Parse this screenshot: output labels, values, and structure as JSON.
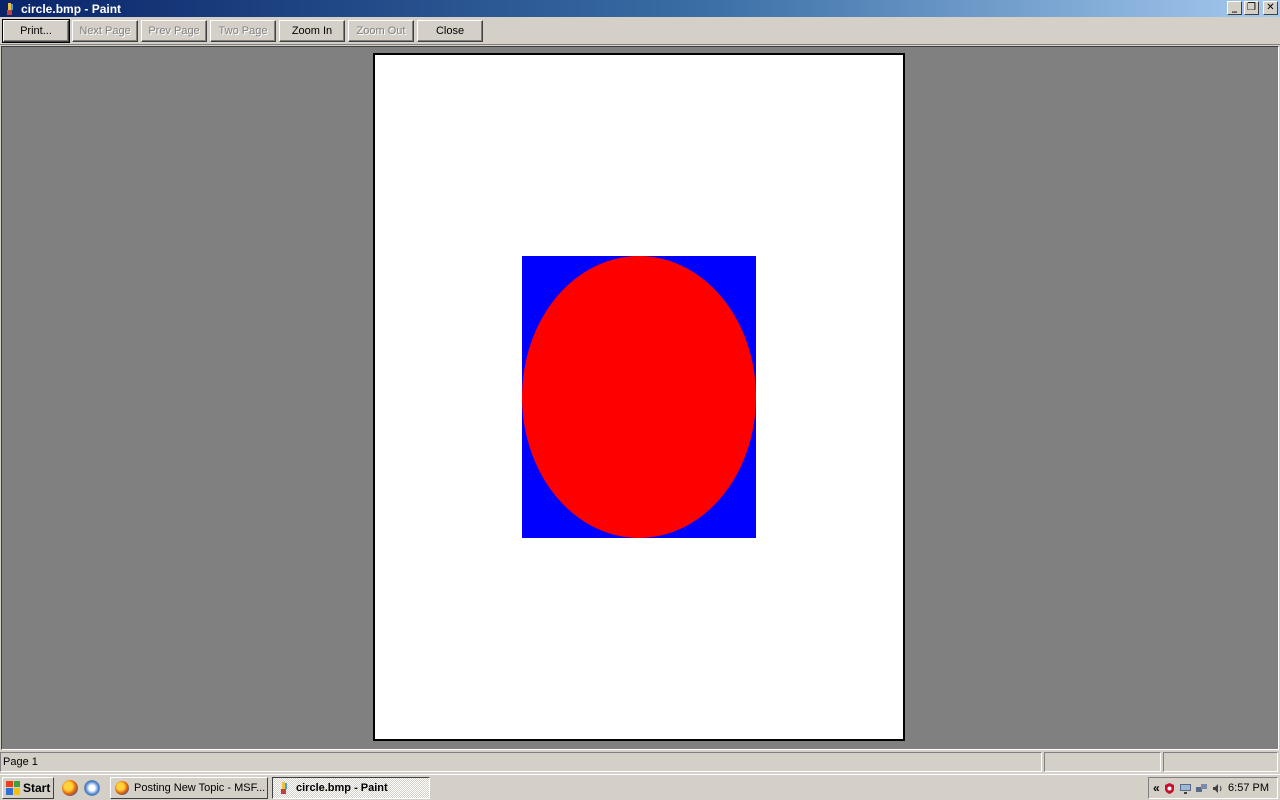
{
  "window": {
    "title": "circle.bmp - Paint",
    "controls": [
      "minimize",
      "restore",
      "close"
    ]
  },
  "toolbar": {
    "buttons": [
      {
        "label": "Print...",
        "enabled": true
      },
      {
        "label": "Next Page",
        "enabled": false
      },
      {
        "label": "Prev Page",
        "enabled": false
      },
      {
        "label": "Two Page",
        "enabled": false
      },
      {
        "label": "Zoom In",
        "enabled": true
      },
      {
        "label": "Zoom Out",
        "enabled": false
      },
      {
        "label": "Close",
        "enabled": true
      }
    ]
  },
  "preview": {
    "image_colors": {
      "background": "#0000ff",
      "ellipse": "#ff0000"
    }
  },
  "status": {
    "page": "Page 1"
  },
  "taskbar": {
    "start_label": "Start",
    "tasks": [
      {
        "label": "Posting New Topic - MSF...",
        "icon": "firefox-icon",
        "active": false
      },
      {
        "label": "circle.bmp - Paint",
        "icon": "paint-icon",
        "active": true
      }
    ],
    "tray_expand": "«",
    "clock": "6:57 PM"
  }
}
